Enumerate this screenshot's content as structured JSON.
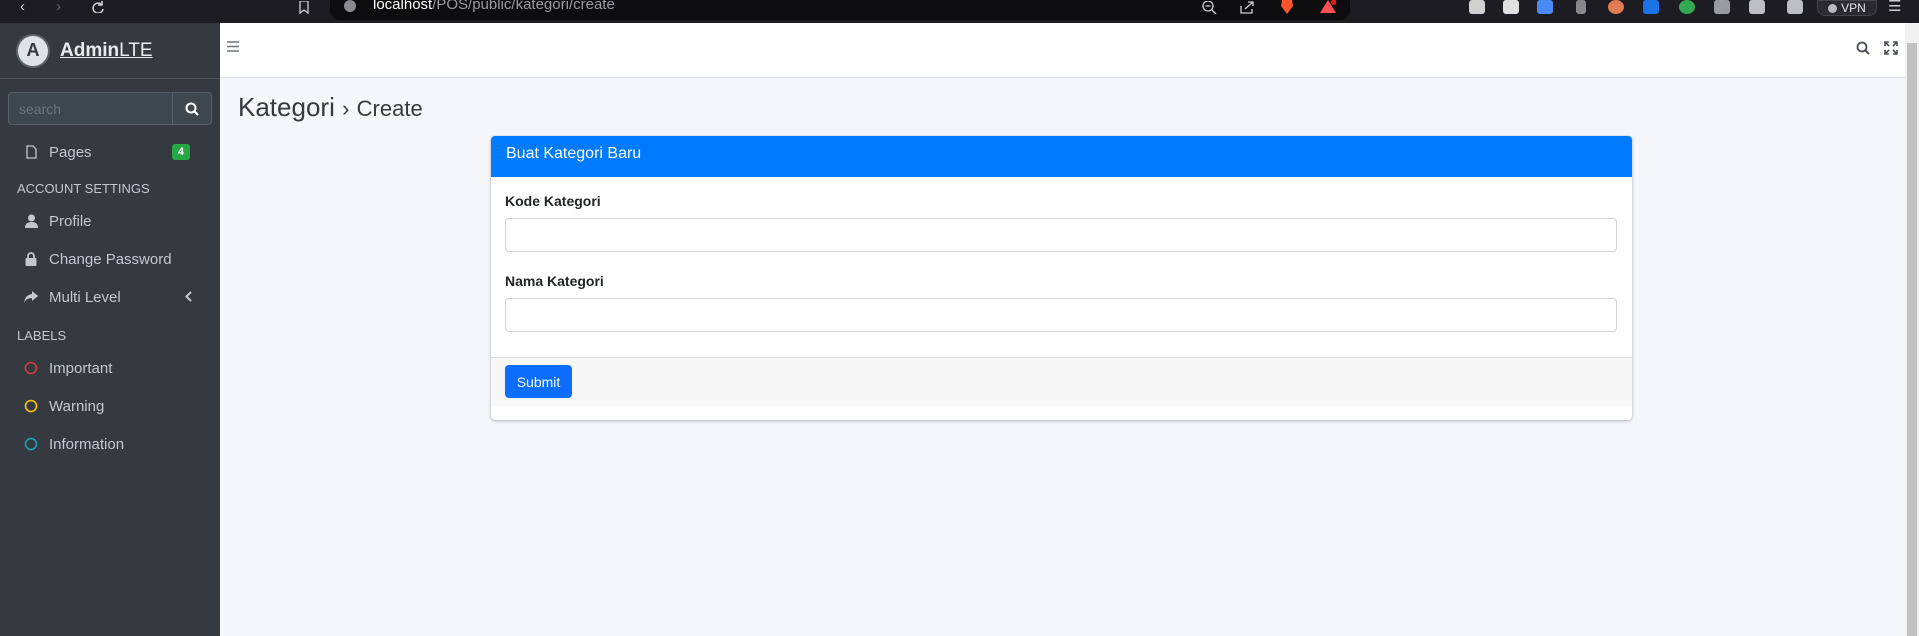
{
  "browser": {
    "url_host": "localhost",
    "url_path": "/POS/public/kategori/create",
    "vpn_label": "VPN"
  },
  "sidebar": {
    "brand_bold": "Admin",
    "brand_rest": "LTE",
    "search_placeholder": "search",
    "pages": {
      "label": "Pages",
      "badge": "4"
    },
    "account_header": "ACCOUNT SETTINGS",
    "account_items": [
      {
        "label": "Profile",
        "icon": "user-icon"
      },
      {
        "label": "Change Password",
        "icon": "lock-icon"
      },
      {
        "label": "Multi Level",
        "icon": "share-icon"
      }
    ],
    "labels_header": "LABELS",
    "labels": [
      {
        "label": "Important",
        "color": "#dc3545"
      },
      {
        "label": "Warning",
        "color": "#ffc107"
      },
      {
        "label": "Information",
        "color": "#17a2b8"
      }
    ]
  },
  "page": {
    "title": "Kategori",
    "separator": "›",
    "subtitle": "Create"
  },
  "form": {
    "header": "Buat Kategori Baru",
    "fields": [
      {
        "label": "Kode Kategori",
        "value": ""
      },
      {
        "label": "Nama Kategori",
        "value": ""
      }
    ],
    "submit_label": "Submit"
  },
  "colors": {
    "primary": "#007bff",
    "button": "#0d6efd",
    "sidebar_bg": "#343a40",
    "badge_green": "#28a745"
  }
}
